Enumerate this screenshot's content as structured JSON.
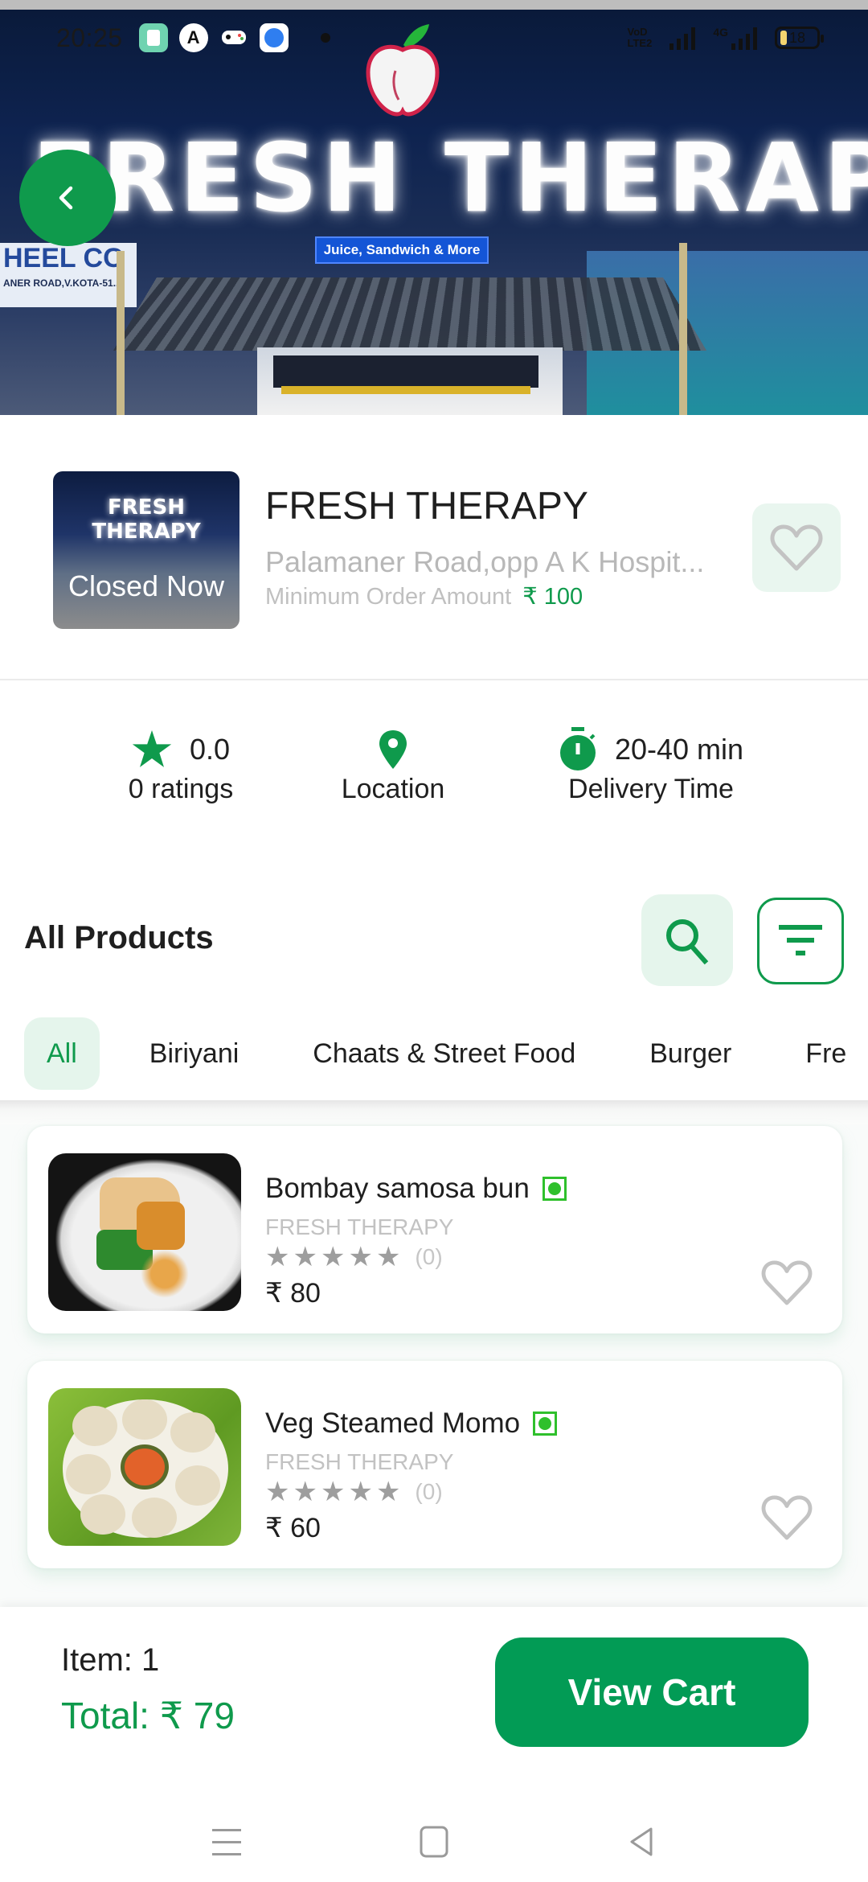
{
  "status_bar": {
    "time": "20:25",
    "app_icons": [
      "notes-app-icon",
      "a-app-icon",
      "gamepad-icon",
      "browser-icon"
    ],
    "network_label": "4G",
    "volte_label_top": "VoD",
    "volte_label_bottom": "LTE2",
    "battery_percent": "18"
  },
  "hero": {
    "sign_text": "FRESH THERAPY",
    "sub_sign_text": "Juice, Sandwich & More",
    "left_building_text": "HEEL CO",
    "left_building_subtext": "ANER ROAD,V.KOTA-51..."
  },
  "store": {
    "thumbnail_sign": "FRESH THERAPY",
    "status_overlay": "Closed Now",
    "name": "FRESH THERAPY",
    "address": "Palamaner Road,opp A K Hospit...",
    "min_order_label": "Minimum Order Amount",
    "min_order_amount": "₹ 100"
  },
  "stats": {
    "rating_value": "0.0",
    "rating_label": "0 ratings",
    "location_label": "Location",
    "delivery_time_value": "20-40 min",
    "delivery_time_label": "Delivery Time"
  },
  "products_section": {
    "title": "All Products",
    "categories": [
      {
        "label": "All",
        "active": true
      },
      {
        "label": "Biriyani",
        "active": false
      },
      {
        "label": "Chaats & Street Food",
        "active": false
      },
      {
        "label": "Burger",
        "active": false
      },
      {
        "label": "Fre",
        "active": false
      }
    ]
  },
  "products": [
    {
      "name": "Bombay samosa bun",
      "store": "FRESH THERAPY",
      "rating_stars": 0,
      "rating_count": "(0)",
      "price": "₹ 80",
      "veg": true
    },
    {
      "name": "Veg Steamed Momo",
      "store": "FRESH THERAPY",
      "rating_stars": 0,
      "rating_count": "(0)",
      "price": "₹ 60",
      "veg": true
    }
  ],
  "cart": {
    "items_label": "Item: 1",
    "total_label": "Total: ₹ 79",
    "view_cart_label": "View Cart"
  },
  "colors": {
    "brand_green": "#0f9a4c",
    "button_green": "#029b55",
    "light_green_bg": "#e5f5ec",
    "veg_green": "#2fc02c",
    "muted_gray": "#c2c2c2"
  }
}
